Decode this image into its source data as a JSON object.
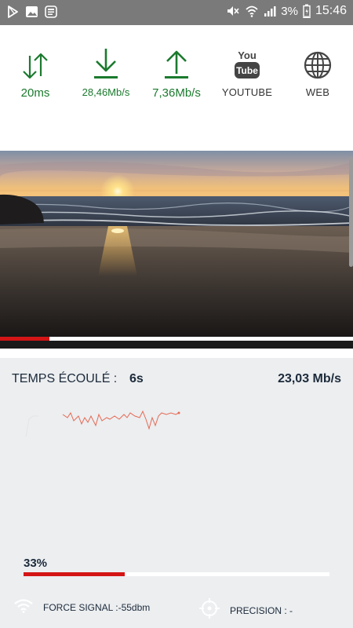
{
  "status_bar": {
    "battery": "3%",
    "time": "15:46",
    "icons": [
      "play-store-icon",
      "image-icon",
      "news-icon",
      "mute-icon",
      "wifi-icon",
      "signal-icon",
      "battery-icon"
    ]
  },
  "metrics": [
    {
      "name": "ping",
      "icon": "arrows-up-down-icon",
      "value": "20ms"
    },
    {
      "name": "download",
      "icon": "download-arrow-icon",
      "value": "28,46Mb/s"
    },
    {
      "name": "upload",
      "icon": "upload-arrow-icon",
      "value": "7,36Mb/s"
    },
    {
      "name": "youtube",
      "icon": "youtube-icon",
      "label": "YOUTUBE",
      "logo_top": "You",
      "logo_bottom": "Tube"
    },
    {
      "name": "web",
      "icon": "globe-icon",
      "label": "WEB"
    }
  ],
  "video": {
    "progress": 0.14,
    "scene": "sunset-beach"
  },
  "test": {
    "elapsed_label": "TEMPS ÉCOULÉ :",
    "elapsed_value": "6s",
    "speed": "23,03 Mb/s",
    "progress_text": "33%",
    "progress": 0.33
  },
  "footer": {
    "signal": "FORCE SIGNAL :-55dbm",
    "precision": "PRECISION : -"
  },
  "colors": {
    "accent_green": "#1b7a2e",
    "accent_red": "#d41515",
    "panel_bg": "#eceef0",
    "status_bar_bg": "#7a7a7a"
  }
}
